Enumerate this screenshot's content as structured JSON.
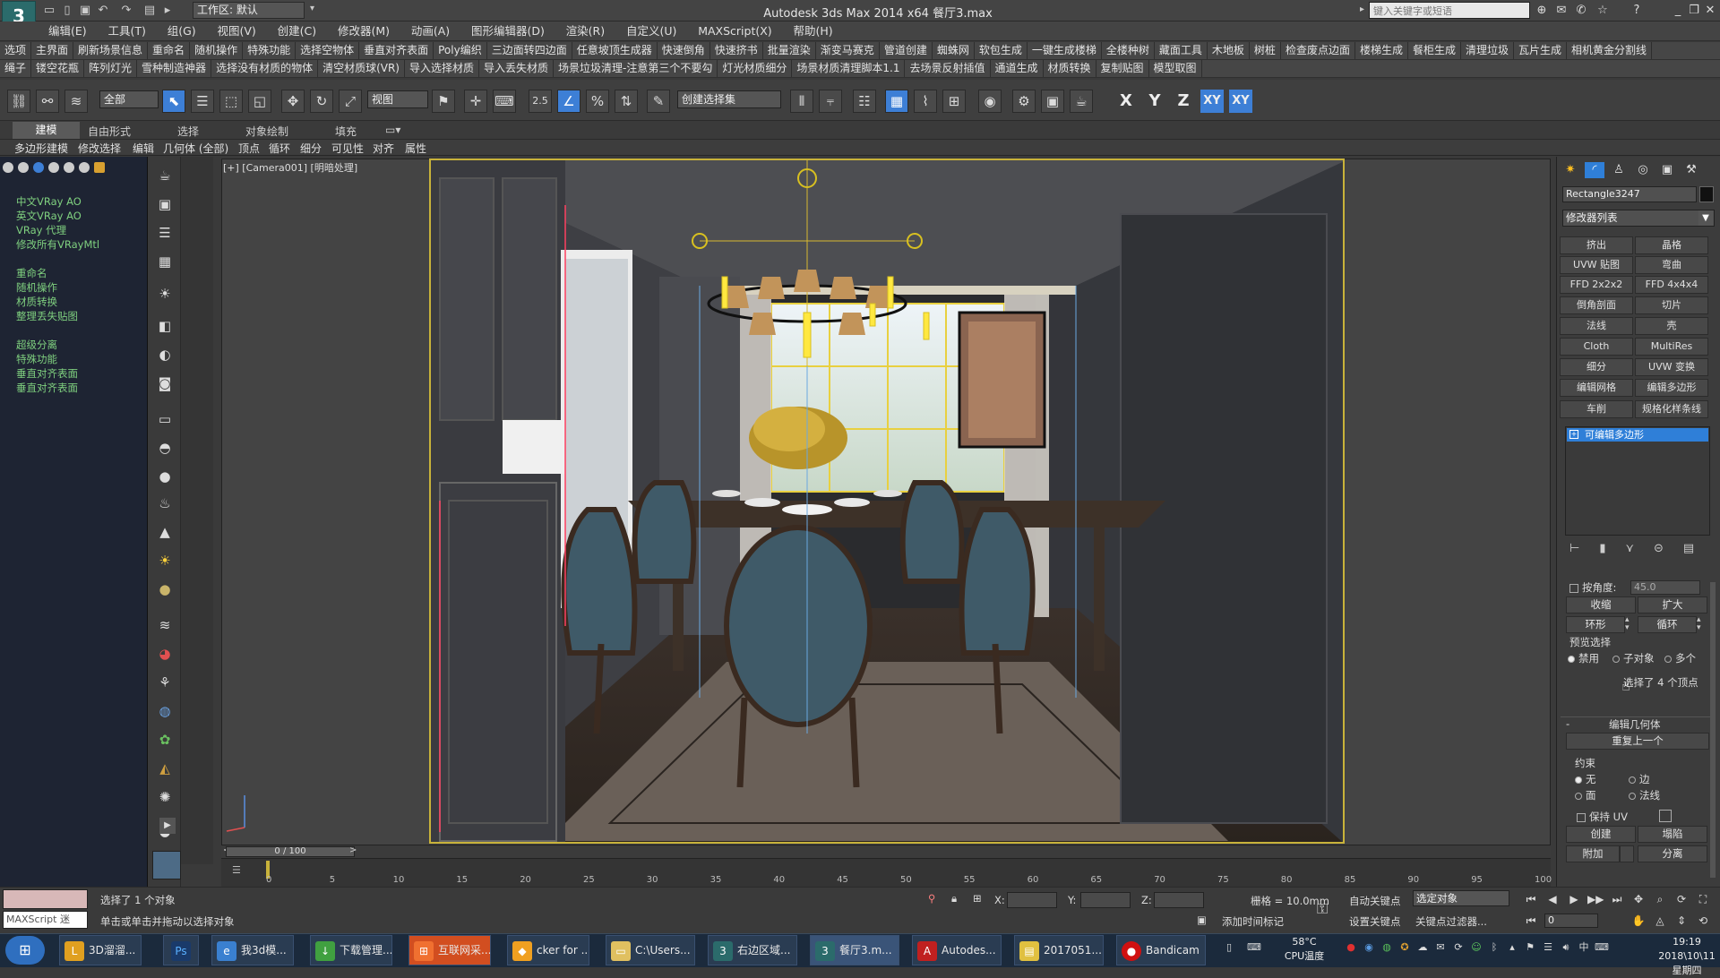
{
  "window": {
    "title": "Autodesk 3ds Max  2014 x64       餐厅3.max",
    "workspace": "工作区: 默认",
    "search_placeholder": "键入关键字或短语"
  },
  "menu": [
    "编辑(E)",
    "工具(T)",
    "组(G)",
    "视图(V)",
    "创建(C)",
    "修改器(M)",
    "动画(A)",
    "图形编辑器(D)",
    "渲染(R)",
    "自定义(U)",
    "MAXScript(X)",
    "帮助(H)"
  ],
  "script_bar_1": [
    "选项",
    "主界面",
    "刷新场景信息",
    "重命名",
    "随机操作",
    "特殊功能",
    "选择空物体",
    "垂直对齐表面",
    "Poly编织",
    "三边面转四边面",
    "任意坡顶生成器",
    "快速倒角",
    "快速挤书",
    "批量渲染",
    "渐变马赛克",
    "管道创建",
    "蜘蛛网",
    "软包生成",
    "一键生成楼梯",
    "全楼种树",
    "藏面工具",
    "木地板",
    "树桩",
    "检查废点边面",
    "楼梯生成",
    "餐柜生成",
    "清理垃圾",
    "瓦片生成",
    "相机黄金分割线"
  ],
  "script_bar_2": [
    "绳子",
    "镂空花瓶",
    "阵列灯光",
    "雪种制造神器",
    "选择没有材质的物体",
    "清空材质球(VR)",
    "导入选择材质",
    "导入丢失材质",
    "场景垃圾清理-注意第三个不要勾",
    "灯光材质细分",
    "场景材质清理脚本1.1",
    "去场景反射插值",
    "通道生成",
    "材质转换",
    "复制贴图",
    "模型取图"
  ],
  "toolbar": {
    "filter": "全部",
    "ref_coord": "视图",
    "named_sel": "创建选择集",
    "snap_label": "2.5",
    "axes": [
      "X",
      "Y",
      "Z",
      "XY",
      "XY"
    ]
  },
  "ribbon_tabs": [
    "建模",
    "自由形式",
    "选择",
    "对象绘制",
    "填充"
  ],
  "ribbon_panel": [
    "多边形建模",
    "修改选择",
    "编辑",
    "几何体 (全部)",
    "顶点",
    "循环",
    "细分",
    "可见性",
    "对齐",
    "属性"
  ],
  "left_panel": {
    "group1": [
      "中文VRay AO",
      "英文VRay AO",
      "VRay 代理",
      "修改所有VRayMtl"
    ],
    "group2": [
      "重命名",
      "随机操作",
      "材质转换",
      "整理丢失贴图"
    ],
    "group3": [
      "超级分离",
      "特殊功能",
      "垂直对齐表面",
      "垂直对齐表面"
    ]
  },
  "viewport": {
    "label": "[+] [Camera001] [明暗处理]"
  },
  "right_panel": {
    "object_name": "Rectangle3247",
    "modifier_list": "修改器列表",
    "modifier_buttons": [
      "挤出",
      "晶格",
      "UVW 贴图",
      "弯曲",
      "FFD 2x2x2",
      "FFD 4x4x4",
      "倒角剖面",
      "切片",
      "法线",
      "壳",
      "Cloth",
      "MultiRes",
      "细分",
      "UVW 变换",
      "编辑网格",
      "编辑多边形",
      "车削",
      "规格化样条线"
    ],
    "stack_item": "可编辑多边形",
    "by_angle_label": "按角度:",
    "by_angle_value": "45.0",
    "shrink": "收缩",
    "grow": "扩大",
    "ring": "环形",
    "loop": "循环",
    "preview_selection": "预览选择",
    "preview_options": [
      "禁用",
      "子对象",
      "多个"
    ],
    "selected_info": "选择了 4 个顶点",
    "edit_geometry": "编辑几何体",
    "repeat_last": "重复上一个",
    "constraints": "约束",
    "constraint_options": [
      "无",
      "边",
      "面",
      "法线"
    ],
    "preserve_uv": "保持 UV",
    "create": "创建",
    "collapse": "塌陷",
    "attach": "附加",
    "detach": "分离"
  },
  "timeline": {
    "slider": "0 / 100",
    "ticks": [
      "0",
      "5",
      "10",
      "15",
      "20",
      "25",
      "30",
      "35",
      "40",
      "45",
      "50",
      "55",
      "60",
      "65",
      "70",
      "75",
      "80",
      "85",
      "90",
      "95",
      "100"
    ]
  },
  "status": {
    "maxscript": "MAXScript 迷",
    "selected": "选择了 1 个对象",
    "prompt": "单击或单击并拖动以选择对象",
    "x_label": "X:",
    "y_label": "Y:",
    "z_label": "Z:",
    "grid": "栅格 = 10.0mm",
    "add_time_tag": "添加时间标记",
    "auto_key": "自动关键点",
    "set_key": "设置关键点",
    "key_filter": "关键点过滤器...",
    "selection_set": "选定对象",
    "frame": "0"
  },
  "taskbar": {
    "tasks": [
      "3D溜溜...",
      "",
      "我3d模...",
      "下载管理...",
      "互联网采...",
      "cker for ...",
      "C:\\Users...",
      "右边区域...",
      "餐厅3.m...",
      "Autodes...",
      "2017051...",
      "Bandicam"
    ],
    "temp": "58°C",
    "temp_label": "CPU温度",
    "time": "19:19",
    "date": "2018\\10\\11 星期四"
  }
}
